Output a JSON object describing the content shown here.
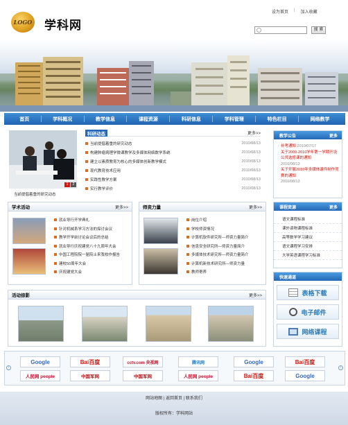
{
  "header": {
    "logo_text": "LOGO",
    "site_title": "学科网",
    "set_home": "设为首页",
    "add_favorite": "加入收藏",
    "search_placeholder": "",
    "search_button": "搜 索"
  },
  "nav": [
    "首页",
    "学科概况",
    "教学信息",
    "课程资源",
    "科研信息",
    "学科管理",
    "特色栏目",
    "网络教学"
  ],
  "research": {
    "title": "科研动态",
    "more": "更多>>",
    "photo_caption": "当前提倡着重的研究动态",
    "pager": [
      "1",
      "2"
    ],
    "items": [
      {
        "title": "当前提倡着重的研究动态",
        "date": "2010/08/13"
      },
      {
        "title": "构建肿瘤病理学微课教学及多媒体网络数学系统",
        "date": "2010/08/13"
      },
      {
        "title": "建立以素质教育为核心的多媒体创新教学模式",
        "date": "2010/08/13"
      },
      {
        "title": "现代教育技术应用",
        "date": "2010/08/13"
      },
      {
        "title": "实践性教学方案",
        "date": "2010/08/13"
      },
      {
        "title": "实行教学评价",
        "date": "2010/08/13"
      }
    ]
  },
  "notice": {
    "title": "教学公告",
    "more": "更多",
    "items": [
      {
        "title": "补考通知",
        "date": "2010/07/17"
      },
      {
        "title": "关于2009-2010学年第一学期开设公共选修课的通知",
        "date": "2010/08/13"
      },
      {
        "title": "关于开展2010年多媒体课件制作竞赛的通知",
        "date": "2010/08/13"
      }
    ]
  },
  "academic": {
    "title": "学术活动",
    "more": "更多>>",
    "items": [
      "就业导行开学典礼",
      "针对机械系学习方法的探讨会议",
      "教学开学前讨论会议后的总结",
      "就业导行庆祝建党八十九周年大会",
      "中国工程院院一届院士来我校作报告",
      "建校50周年大会",
      "庆祝建党大会"
    ]
  },
  "faculty": {
    "title": "师资力量",
    "more": "更多>>",
    "items": [
      "岗位介绍",
      "学校师资情况",
      "计算机软件研究所—师资力量简介",
      "信息安全研究所—师资力量简介",
      "多媒体技术研究所—师资力量简介",
      "计算机新技术研究所—师资力量",
      "教师寄养"
    ]
  },
  "courses": {
    "title": "课程资源",
    "more": "更多",
    "items": [
      "语文课程标准",
      "课外读物课程标准",
      "高等数学学习建议",
      "语文课程学习安排",
      "大学英语课程学习标准"
    ]
  },
  "quick": {
    "title": "快速通道",
    "items": [
      {
        "label": "表格下载",
        "icon": "table-icon"
      },
      {
        "label": "电子邮件",
        "icon": "headset-icon"
      },
      {
        "label": "网络课程",
        "icon": "screen-icon"
      }
    ]
  },
  "activities": {
    "title": "活动掠影",
    "more": "更多>>"
  },
  "links": {
    "row1": [
      {
        "text": "Google",
        "color": "#3366cc"
      },
      {
        "text": "Bai百度",
        "color": "#d4150c"
      },
      {
        "text": "cctv.com 央视网",
        "color": "#c8102e"
      },
      {
        "text": "腾讯网",
        "color": "#1a7cc9"
      },
      {
        "text": "Google",
        "color": "#3366cc"
      },
      {
        "text": "Bai百度",
        "color": "#d4150c"
      }
    ],
    "row2": [
      {
        "text": "人民网 people",
        "color": "#c8102e"
      },
      {
        "text": "中国军网",
        "color": "#b8181b"
      },
      {
        "text": "中国军网",
        "color": "#b8181b"
      },
      {
        "text": "人民网 people",
        "color": "#c8102e"
      },
      {
        "text": "Bai百度",
        "color": "#d4150c"
      },
      {
        "text": "Google",
        "color": "#3366cc"
      }
    ]
  },
  "footer": {
    "links": [
      "网站地图",
      "返回首页",
      "联系我们"
    ],
    "copyright": "版权所有：学科网站"
  },
  "colors": {
    "nav_blue": "#1f62b0",
    "accent_red": "#d4150c",
    "bullet_orange": "#e26a1c"
  }
}
